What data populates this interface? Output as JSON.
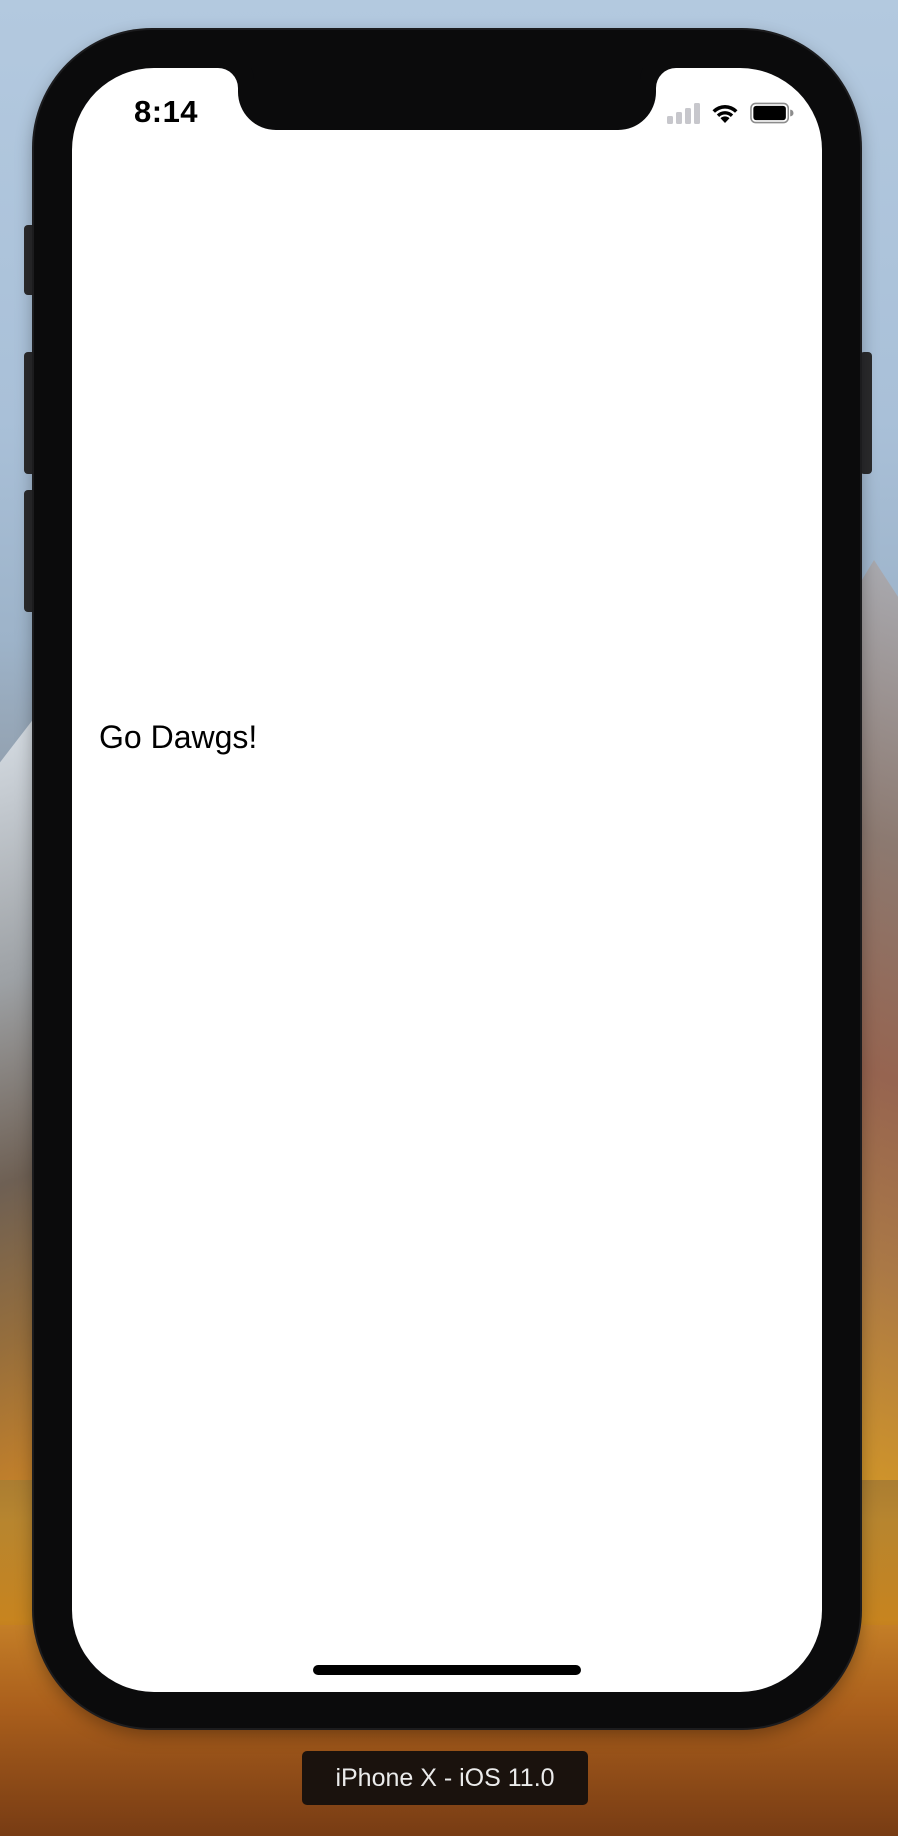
{
  "status_bar": {
    "time": "8:14",
    "signal_icon": "cellular-signal-icon",
    "wifi_icon": "wifi-icon",
    "battery_icon": "battery-icon"
  },
  "content": {
    "text": "Go Dawgs!"
  },
  "simulator": {
    "device_label": "iPhone X - iOS 11.0"
  },
  "colors": {
    "screen_background": "#ffffff",
    "text": "#000000",
    "device_frame": "#0b0b0c"
  }
}
